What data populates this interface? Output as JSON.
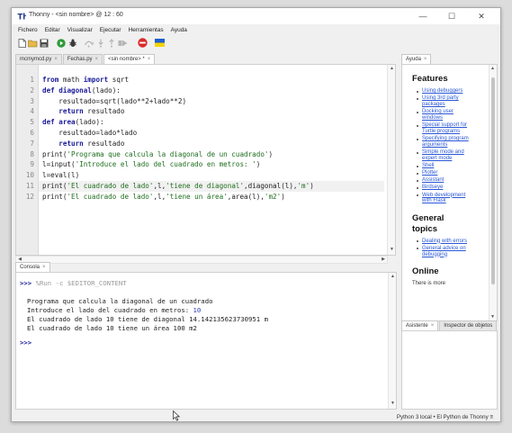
{
  "window": {
    "title": "Thonny  -  <sin nombre>  @  12 : 60",
    "controls": {
      "minimize": "—",
      "maximize": "☐",
      "close": "✕"
    }
  },
  "menubar": [
    "Fichero",
    "Editar",
    "Visualizar",
    "Ejecutar",
    "Herramientas",
    "Ayuda"
  ],
  "toolbar": {
    "buttons": [
      "new-file-icon",
      "open-folder-icon",
      "save-icon",
      "run-icon",
      "debug-icon",
      "step-over-icon",
      "step-into-icon",
      "step-out-icon",
      "resume-icon",
      "stop-icon",
      "ukraine-flag-icon"
    ],
    "colors": {
      "run": "#2f9a38",
      "stop": "#d92b2b",
      "flag_blue": "#1f5fcf",
      "flag_yellow": "#f5d300"
    }
  },
  "editor": {
    "tabs": [
      {
        "label": "mcmymcd.py",
        "close": "×",
        "active": false
      },
      {
        "label": "Fechas.py",
        "close": "×",
        "active": false
      },
      {
        "label": "<sin nombre> *",
        "close": "×",
        "active": true
      }
    ],
    "line_numbers": [
      "1",
      "2",
      "3",
      "4",
      "5",
      "6",
      "7",
      "8",
      "9",
      "10",
      "11",
      "12"
    ],
    "lines": [
      {
        "parts": [
          [
            "kw",
            "from"
          ],
          [
            "",
            " math "
          ],
          [
            "kw",
            "import"
          ],
          [
            "",
            " sqrt"
          ]
        ]
      },
      {
        "parts": [
          [
            "kw",
            "def"
          ],
          [
            "",
            " "
          ],
          [
            "fn",
            "diagonal"
          ],
          [
            "",
            "(lado):"
          ]
        ]
      },
      {
        "parts": [
          [
            "",
            "    resultado=sqrt(lado**2+lado**2)"
          ]
        ]
      },
      {
        "parts": [
          [
            "",
            "    "
          ],
          [
            "kw",
            "return"
          ],
          [
            "",
            " resultado"
          ]
        ]
      },
      {
        "parts": [
          [
            "kw",
            "def"
          ],
          [
            "",
            " "
          ],
          [
            "fn",
            "area"
          ],
          [
            "",
            "(lado):"
          ]
        ]
      },
      {
        "parts": [
          [
            "",
            "    resultado=lado*lado"
          ]
        ]
      },
      {
        "parts": [
          [
            "",
            "    "
          ],
          [
            "kw",
            "return"
          ],
          [
            "",
            " resultado"
          ]
        ]
      },
      {
        "parts": [
          [
            "",
            "print("
          ],
          [
            "str",
            "'Programa que calcula la diagonal de un cuadrado'"
          ],
          [
            "",
            ")"
          ]
        ]
      },
      {
        "parts": [
          [
            "",
            "l=input("
          ],
          [
            "str",
            "'Introduce el lado del cuadrado en metros: '"
          ],
          [
            "",
            ")"
          ]
        ]
      },
      {
        "parts": [
          [
            "",
            "l=eval(l)"
          ]
        ]
      },
      {
        "parts": [
          [
            "",
            "print("
          ],
          [
            "str",
            "'El cuadrado de lado'"
          ],
          [
            "",
            ",l,"
          ],
          [
            "str",
            "'tiene de diagonal'"
          ],
          [
            "",
            ",diagonal(l),"
          ],
          [
            "str",
            "'m'"
          ],
          [
            "",
            ")"
          ]
        ]
      },
      {
        "parts": [
          [
            "",
            "print("
          ],
          [
            "str",
            "'El cuadrado de lado'"
          ],
          [
            "",
            ",l,"
          ],
          [
            "str",
            "'tiene un área'"
          ],
          [
            "",
            ",area(l),"
          ],
          [
            "str",
            "'m2'"
          ],
          [
            "",
            ")"
          ]
        ]
      }
    ],
    "highlighted_line": 11
  },
  "console": {
    "tab": {
      "label": "Consola",
      "close": "×"
    },
    "prompt": ">>>",
    "run_command": "%Run -c $EDITOR_CONTENT",
    "output": [
      {
        "text": "Programa que calcula la diagonal de un cuadrado"
      },
      {
        "text": "Introduce el lado del cuadrado en metros: ",
        "input": "10"
      },
      {
        "text": "El cuadrado de lado 10 tiene de diagonal 14.142135623730951 m"
      },
      {
        "text": "El cuadrado de lado 10 tiene un área 100 m2"
      }
    ],
    "final_prompt": ">>>"
  },
  "help_panel": {
    "tab": {
      "label": "Ayuda",
      "close": "×"
    },
    "sections": [
      {
        "heading": "Features",
        "links": [
          [
            "Using debuggers"
          ],
          [
            "Using 3rd party",
            "packages"
          ],
          [
            "Docking user",
            "windows"
          ],
          [
            "Special support for",
            "Turtle programs"
          ],
          [
            "Specifying program",
            "arguments"
          ],
          [
            "Simple mode and",
            "expert mode"
          ],
          [
            "Shell"
          ],
          [
            "Plotter"
          ],
          [
            "Assistant"
          ],
          [
            "Birdseye"
          ],
          [
            "Web development",
            "with Flask"
          ]
        ]
      },
      {
        "heading_lines": [
          "General",
          "topics"
        ],
        "links": [
          [
            "Dealing with errors"
          ],
          [
            "General advice on",
            "debugging"
          ]
        ]
      },
      {
        "heading": "Online",
        "text": "There is more"
      }
    ]
  },
  "bottom_panel": {
    "tabs": [
      {
        "label": "Asistente",
        "close": "×",
        "active": true
      },
      {
        "label": "Inspector de objetos",
        "active": false
      }
    ]
  },
  "statusbar": {
    "text": "Python 3 local  •  El Python de Thonny  ≡"
  }
}
